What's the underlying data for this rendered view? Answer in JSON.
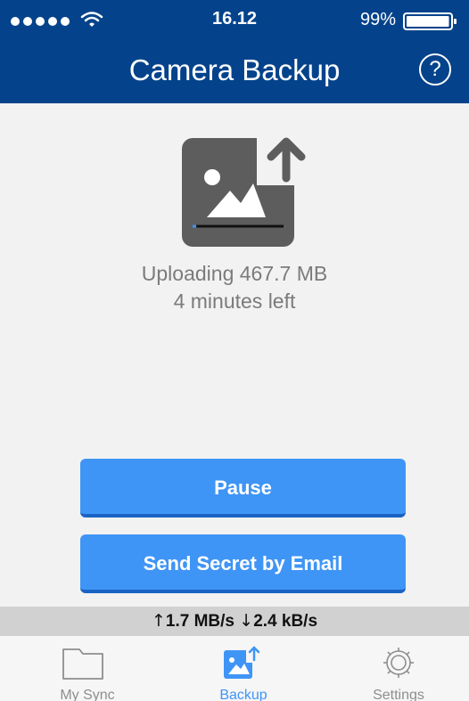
{
  "status_bar": {
    "time": "16.12",
    "battery_percent": "99%",
    "battery_level": 0.99,
    "signal_bars": 5
  },
  "nav": {
    "title": "Camera Backup",
    "help_label": "?"
  },
  "upload": {
    "line1": "Uploading 467.7 MB",
    "line2": "4 minutes left",
    "progress": 0.04
  },
  "buttons": {
    "pause": "Pause",
    "send_secret": "Send Secret by Email"
  },
  "speed": {
    "upload_arrow": "↑",
    "upload": "1.7 MB/s",
    "download_arrow": "↓",
    "download": "2.4 kB/s"
  },
  "tabs": [
    {
      "label": "My Sync",
      "icon": "folder-icon",
      "active": false
    },
    {
      "label": "Backup",
      "icon": "photo-upload-icon",
      "active": true
    },
    {
      "label": "Settings",
      "icon": "gear-icon",
      "active": false
    }
  ],
  "colors": {
    "header": "#04438b",
    "accent": "#3f95f5",
    "background": "#f2f2f2"
  }
}
